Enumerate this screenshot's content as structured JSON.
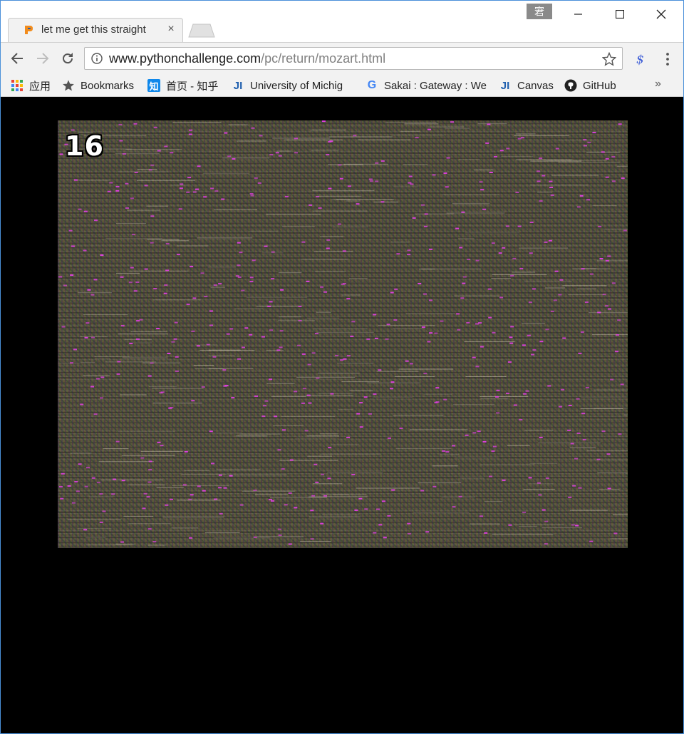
{
  "tab": {
    "title": "let me get this straight",
    "close_glyph": "×"
  },
  "profile": {
    "badge": "宭"
  },
  "window_controls": {
    "minimize": "minimize-icon",
    "maximize": "maximize-icon",
    "close": "close-icon"
  },
  "address_bar": {
    "host": "www.pythonchallenge.com",
    "path": "/pc/return/mozart.html"
  },
  "bookmarks": [
    {
      "label": "应用",
      "icon": "apps-grid-icon"
    },
    {
      "label": "Bookmarks",
      "icon": "star-icon"
    },
    {
      "label": "首页 - 知乎",
      "icon": "zhihu-icon",
      "icon_text": "知"
    },
    {
      "label": "University of Michig",
      "icon": "ji-icon",
      "icon_text": "JI"
    },
    {
      "label": "Sakai : Gateway : We",
      "icon": "google-icon",
      "icon_text": "G"
    },
    {
      "label": "Canvas",
      "icon": "ji-icon",
      "icon_text": "JI"
    },
    {
      "label": "GitHub",
      "icon": "github-icon"
    }
  ],
  "bookmarks_overflow": "»",
  "content": {
    "level_number": "16",
    "image": "noise-image"
  },
  "colors": {
    "accent": "#4a90d9",
    "page_background": "#000000",
    "noise_pink": "#e040e0"
  }
}
